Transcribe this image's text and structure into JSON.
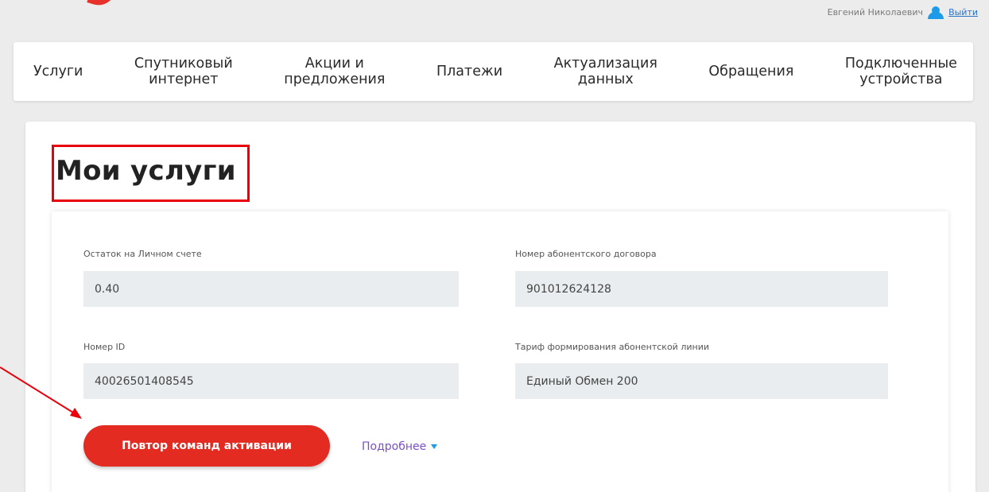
{
  "header": {
    "user_name": "Евгений Николаевич",
    "logout_label": "Выйти"
  },
  "nav": {
    "items": [
      {
        "label": "Услуги"
      },
      {
        "label": "Спутниковый\nинтернет"
      },
      {
        "label": "Акции и\nпредложения"
      },
      {
        "label": "Платежи"
      },
      {
        "label": "Актуализация\nданных"
      },
      {
        "label": "Обращения"
      },
      {
        "label": "Подключенные\nустройства"
      }
    ]
  },
  "main": {
    "title": "Мои услуги",
    "fields": {
      "balance": {
        "label": "Остаток на Личном счете",
        "value": "0.40"
      },
      "contract": {
        "label": "Номер абонентского договора",
        "value": "901012624128"
      },
      "id": {
        "label": "Номер ID",
        "value": "40026501408545"
      },
      "tariff": {
        "label": "Тариф формирования абонентской линии",
        "value": "Единый Обмен 200"
      }
    },
    "activate_button": "Повтор команд активации",
    "more_link": "Подробнее"
  },
  "colors": {
    "accent_red": "#e32b22",
    "link_purple": "#7b4fc6",
    "annotation_red": "#e8000b",
    "field_bg": "#e9edef"
  }
}
